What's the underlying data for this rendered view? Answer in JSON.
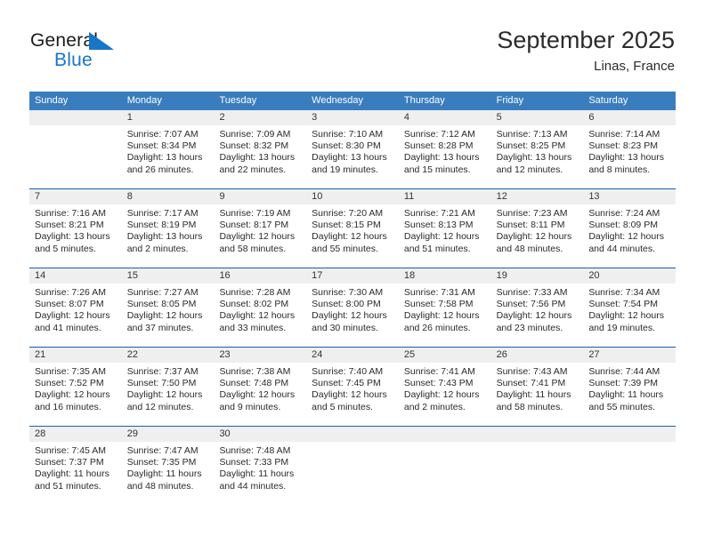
{
  "brand": {
    "name_part1": "General",
    "name_part2": "Blue",
    "mark": "triangle-logo-icon"
  },
  "header": {
    "title": "September 2025",
    "subtitle": "Linas, France"
  },
  "colors": {
    "header_blue": "#3a7dbf",
    "row_divider_blue": "#1a5fa8",
    "brand_blue": "#1876c8",
    "day_band_gray": "#efefef"
  },
  "weekdays": [
    "Sunday",
    "Monday",
    "Tuesday",
    "Wednesday",
    "Thursday",
    "Friday",
    "Saturday"
  ],
  "weeks": [
    [
      {
        "day": "",
        "lines": []
      },
      {
        "day": "1",
        "lines": [
          "Sunrise: 7:07 AM",
          "Sunset: 8:34 PM",
          "Daylight: 13 hours",
          "and 26 minutes."
        ]
      },
      {
        "day": "2",
        "lines": [
          "Sunrise: 7:09 AM",
          "Sunset: 8:32 PM",
          "Daylight: 13 hours",
          "and 22 minutes."
        ]
      },
      {
        "day": "3",
        "lines": [
          "Sunrise: 7:10 AM",
          "Sunset: 8:30 PM",
          "Daylight: 13 hours",
          "and 19 minutes."
        ]
      },
      {
        "day": "4",
        "lines": [
          "Sunrise: 7:12 AM",
          "Sunset: 8:28 PM",
          "Daylight: 13 hours",
          "and 15 minutes."
        ]
      },
      {
        "day": "5",
        "lines": [
          "Sunrise: 7:13 AM",
          "Sunset: 8:25 PM",
          "Daylight: 13 hours",
          "and 12 minutes."
        ]
      },
      {
        "day": "6",
        "lines": [
          "Sunrise: 7:14 AM",
          "Sunset: 8:23 PM",
          "Daylight: 13 hours",
          "and 8 minutes."
        ]
      }
    ],
    [
      {
        "day": "7",
        "lines": [
          "Sunrise: 7:16 AM",
          "Sunset: 8:21 PM",
          "Daylight: 13 hours",
          "and 5 minutes."
        ]
      },
      {
        "day": "8",
        "lines": [
          "Sunrise: 7:17 AM",
          "Sunset: 8:19 PM",
          "Daylight: 13 hours",
          "and 2 minutes."
        ]
      },
      {
        "day": "9",
        "lines": [
          "Sunrise: 7:19 AM",
          "Sunset: 8:17 PM",
          "Daylight: 12 hours",
          "and 58 minutes."
        ]
      },
      {
        "day": "10",
        "lines": [
          "Sunrise: 7:20 AM",
          "Sunset: 8:15 PM",
          "Daylight: 12 hours",
          "and 55 minutes."
        ]
      },
      {
        "day": "11",
        "lines": [
          "Sunrise: 7:21 AM",
          "Sunset: 8:13 PM",
          "Daylight: 12 hours",
          "and 51 minutes."
        ]
      },
      {
        "day": "12",
        "lines": [
          "Sunrise: 7:23 AM",
          "Sunset: 8:11 PM",
          "Daylight: 12 hours",
          "and 48 minutes."
        ]
      },
      {
        "day": "13",
        "lines": [
          "Sunrise: 7:24 AM",
          "Sunset: 8:09 PM",
          "Daylight: 12 hours",
          "and 44 minutes."
        ]
      }
    ],
    [
      {
        "day": "14",
        "lines": [
          "Sunrise: 7:26 AM",
          "Sunset: 8:07 PM",
          "Daylight: 12 hours",
          "and 41 minutes."
        ]
      },
      {
        "day": "15",
        "lines": [
          "Sunrise: 7:27 AM",
          "Sunset: 8:05 PM",
          "Daylight: 12 hours",
          "and 37 minutes."
        ]
      },
      {
        "day": "16",
        "lines": [
          "Sunrise: 7:28 AM",
          "Sunset: 8:02 PM",
          "Daylight: 12 hours",
          "and 33 minutes."
        ]
      },
      {
        "day": "17",
        "lines": [
          "Sunrise: 7:30 AM",
          "Sunset: 8:00 PM",
          "Daylight: 12 hours",
          "and 30 minutes."
        ]
      },
      {
        "day": "18",
        "lines": [
          "Sunrise: 7:31 AM",
          "Sunset: 7:58 PM",
          "Daylight: 12 hours",
          "and 26 minutes."
        ]
      },
      {
        "day": "19",
        "lines": [
          "Sunrise: 7:33 AM",
          "Sunset: 7:56 PM",
          "Daylight: 12 hours",
          "and 23 minutes."
        ]
      },
      {
        "day": "20",
        "lines": [
          "Sunrise: 7:34 AM",
          "Sunset: 7:54 PM",
          "Daylight: 12 hours",
          "and 19 minutes."
        ]
      }
    ],
    [
      {
        "day": "21",
        "lines": [
          "Sunrise: 7:35 AM",
          "Sunset: 7:52 PM",
          "Daylight: 12 hours",
          "and 16 minutes."
        ]
      },
      {
        "day": "22",
        "lines": [
          "Sunrise: 7:37 AM",
          "Sunset: 7:50 PM",
          "Daylight: 12 hours",
          "and 12 minutes."
        ]
      },
      {
        "day": "23",
        "lines": [
          "Sunrise: 7:38 AM",
          "Sunset: 7:48 PM",
          "Daylight: 12 hours",
          "and 9 minutes."
        ]
      },
      {
        "day": "24",
        "lines": [
          "Sunrise: 7:40 AM",
          "Sunset: 7:45 PM",
          "Daylight: 12 hours",
          "and 5 minutes."
        ]
      },
      {
        "day": "25",
        "lines": [
          "Sunrise: 7:41 AM",
          "Sunset: 7:43 PM",
          "Daylight: 12 hours",
          "and 2 minutes."
        ]
      },
      {
        "day": "26",
        "lines": [
          "Sunrise: 7:43 AM",
          "Sunset: 7:41 PM",
          "Daylight: 11 hours",
          "and 58 minutes."
        ]
      },
      {
        "day": "27",
        "lines": [
          "Sunrise: 7:44 AM",
          "Sunset: 7:39 PM",
          "Daylight: 11 hours",
          "and 55 minutes."
        ]
      }
    ],
    [
      {
        "day": "28",
        "lines": [
          "Sunrise: 7:45 AM",
          "Sunset: 7:37 PM",
          "Daylight: 11 hours",
          "and 51 minutes."
        ]
      },
      {
        "day": "29",
        "lines": [
          "Sunrise: 7:47 AM",
          "Sunset: 7:35 PM",
          "Daylight: 11 hours",
          "and 48 minutes."
        ]
      },
      {
        "day": "30",
        "lines": [
          "Sunrise: 7:48 AM",
          "Sunset: 7:33 PM",
          "Daylight: 11 hours",
          "and 44 minutes."
        ]
      },
      {
        "day": "",
        "lines": []
      },
      {
        "day": "",
        "lines": []
      },
      {
        "day": "",
        "lines": []
      },
      {
        "day": "",
        "lines": []
      }
    ]
  ]
}
